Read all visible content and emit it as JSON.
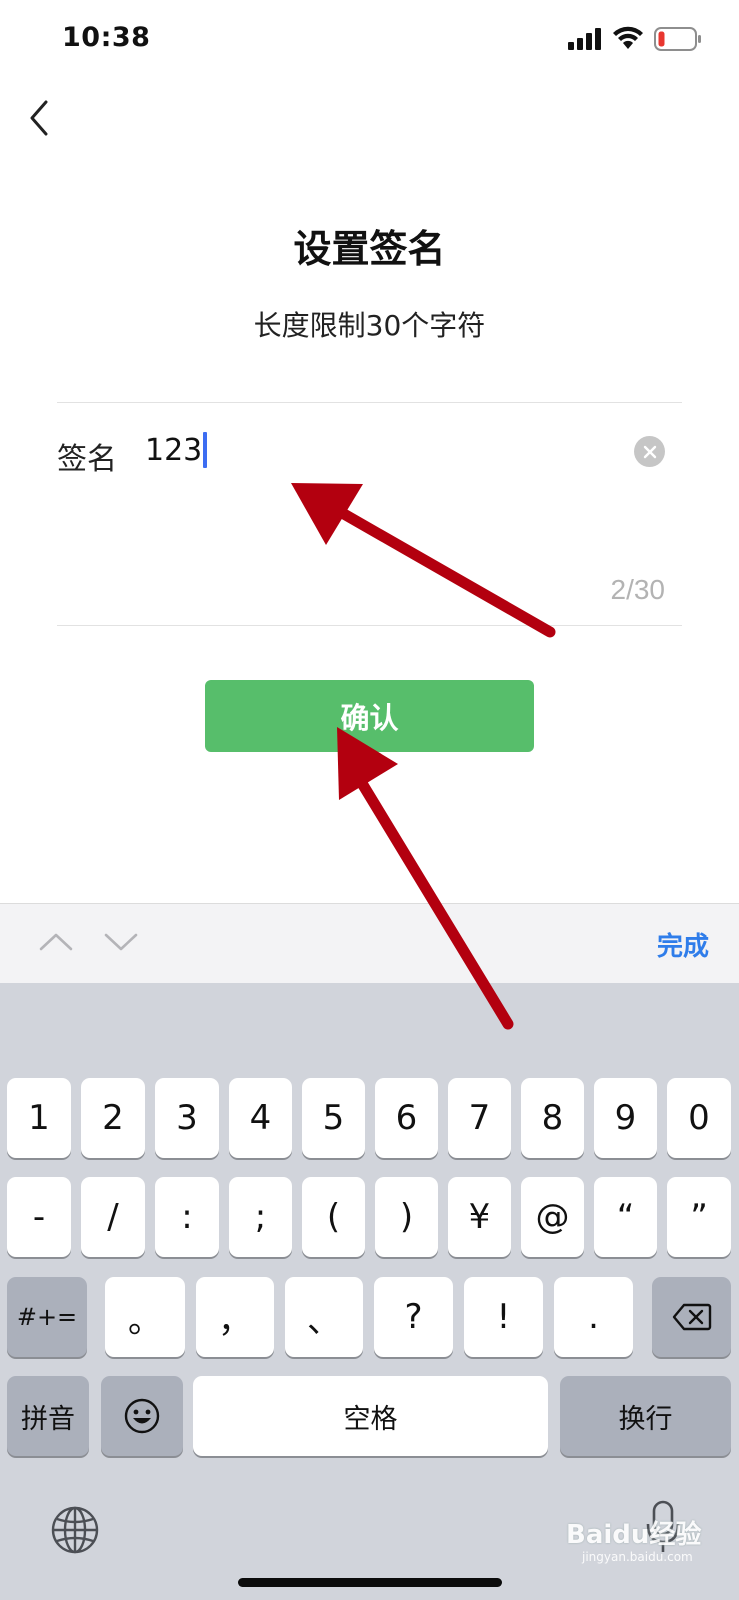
{
  "status_bar": {
    "time": "10:38"
  },
  "page": {
    "title": "设置签名",
    "subtitle": "长度限制30个字符"
  },
  "signature_field": {
    "label": "签名",
    "value": "123",
    "counter": "2/30"
  },
  "confirm_label": "确认",
  "keyboard_toolbar": {
    "done_label": "完成"
  },
  "keyboard": {
    "row1": [
      "1",
      "2",
      "3",
      "4",
      "5",
      "6",
      "7",
      "8",
      "9",
      "0"
    ],
    "row2": [
      "-",
      "/",
      ":",
      ";",
      "(",
      ")",
      "¥",
      "@",
      "“",
      "”"
    ],
    "row3": [
      "。",
      "，",
      "、",
      "?",
      "!",
      "."
    ],
    "row3_mode": "#+=",
    "row4_pinyin": "拼音",
    "row4_space": "空格",
    "row4_return": "换行"
  },
  "watermark": {
    "brand": "Baidu经验",
    "url": "jingyan.baidu.com"
  },
  "colors": {
    "confirm_green": "#57be6b",
    "done_blue": "#2f7dea",
    "caret_blue": "#3d6df2",
    "annotation_red": "#b3000f",
    "keyboard_bg": "#d1d4db"
  }
}
